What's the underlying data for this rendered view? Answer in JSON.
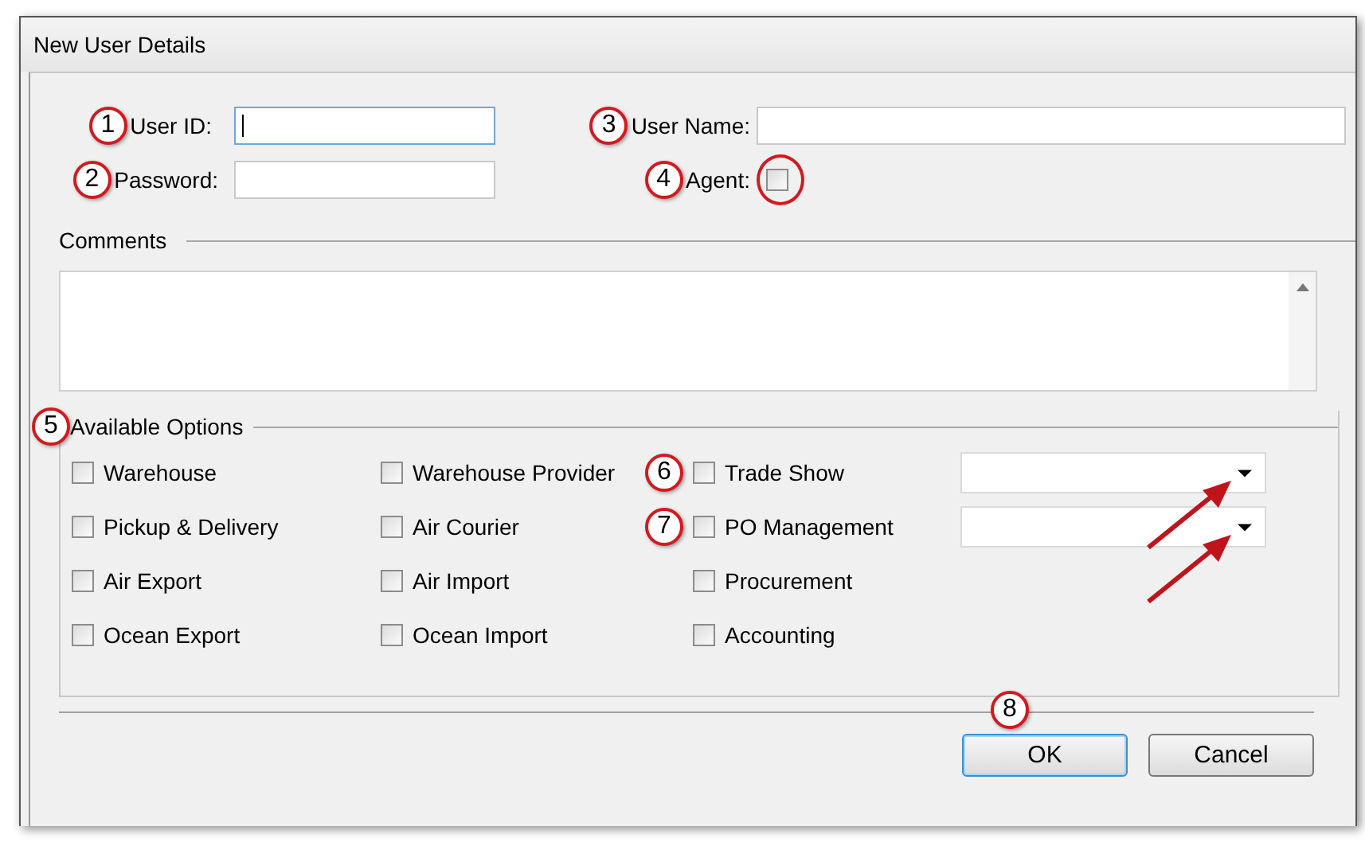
{
  "window": {
    "title": "New User Details"
  },
  "fields": [
    {
      "kind": "text",
      "label": "User ID:",
      "callout": "1",
      "focused": true
    },
    {
      "kind": "text",
      "label": "User Name:",
      "callout": "3",
      "focused": false
    },
    {
      "kind": "text",
      "label": "Password:",
      "callout": "2",
      "focused": false
    },
    {
      "kind": "checkbox",
      "label": "Agent:",
      "callout": "4",
      "checked": false,
      "ringed": true
    }
  ],
  "comments": {
    "label": "Comments"
  },
  "options": {
    "label": "Available Options",
    "callout": "5",
    "items": [
      {
        "label": "Warehouse",
        "checked": false
      },
      {
        "label": "Warehouse Provider",
        "checked": false
      },
      {
        "label": "Trade Show",
        "checked": false,
        "callout": "6",
        "dropdown": true,
        "arrow": true
      },
      {
        "label": "Pickup & Delivery",
        "checked": false
      },
      {
        "label": "Air Courier",
        "checked": false
      },
      {
        "label": "PO Management",
        "checked": false,
        "callout": "7",
        "dropdown": true,
        "arrow": true
      },
      {
        "label": "Air Export",
        "checked": false
      },
      {
        "label": "Air Import",
        "checked": false
      },
      {
        "label": "Procurement",
        "checked": false
      },
      {
        "label": "Ocean Export",
        "checked": false
      },
      {
        "label": "Ocean Import",
        "checked": false
      },
      {
        "label": "Accounting",
        "checked": false
      }
    ]
  },
  "buttons": [
    {
      "label": "OK",
      "default": true,
      "callout": "8"
    },
    {
      "label": "Cancel",
      "default": false
    }
  ]
}
